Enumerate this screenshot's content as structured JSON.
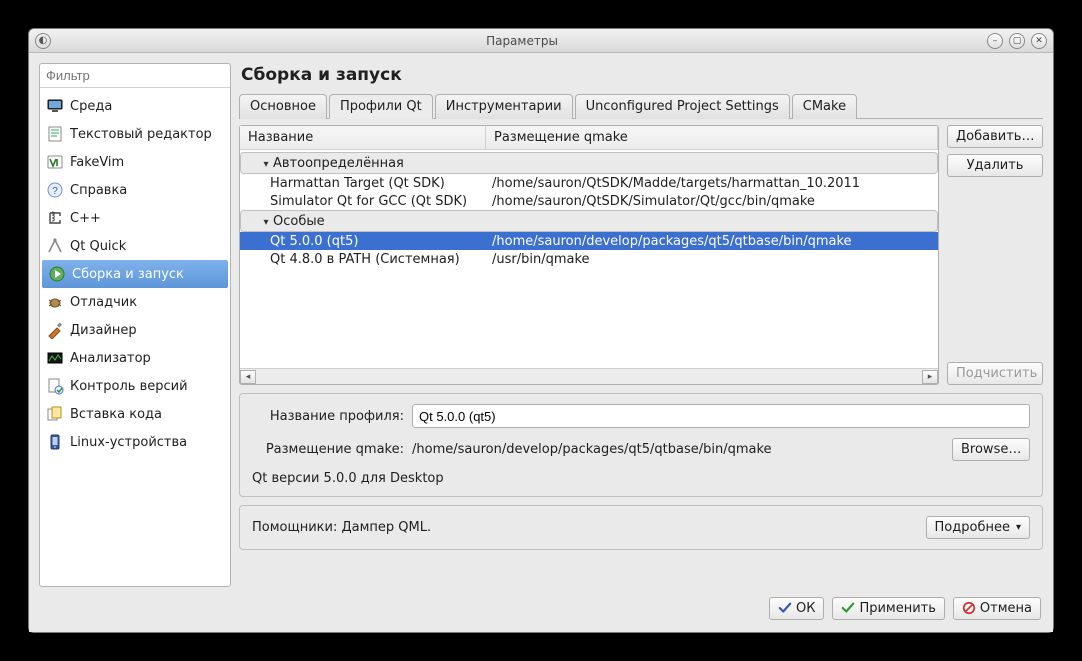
{
  "window": {
    "title": "Параметры"
  },
  "filter": {
    "placeholder": "Фильтр"
  },
  "categories": [
    {
      "label": "Среда",
      "icon": "monitor"
    },
    {
      "label": "Текстовый редактор",
      "icon": "text-editor"
    },
    {
      "label": "FakeVim",
      "icon": "fakevim"
    },
    {
      "label": "Справка",
      "icon": "help"
    },
    {
      "label": "C++",
      "icon": "cpp"
    },
    {
      "label": "Qt Quick",
      "icon": "qtquick"
    },
    {
      "label": "Сборка и запуск",
      "icon": "build-run"
    },
    {
      "label": "Отладчик",
      "icon": "debugger"
    },
    {
      "label": "Дизайнер",
      "icon": "designer"
    },
    {
      "label": "Анализатор",
      "icon": "analyzer"
    },
    {
      "label": "Контроль версий",
      "icon": "vcs"
    },
    {
      "label": "Вставка кода",
      "icon": "code-paste"
    },
    {
      "label": "Linux-устройства",
      "icon": "linux-devices"
    }
  ],
  "selected_category_label": "Сборка и запуск",
  "page": {
    "heading": "Сборка и запуск",
    "tabs": [
      "Основное",
      "Профили Qt",
      "Инструментарии",
      "Unconfigured Project Settings",
      "CMake"
    ],
    "active_tab": "Профили Qt"
  },
  "versions_table": {
    "columns": [
      "Название",
      "Размещение qmake"
    ],
    "groups": [
      {
        "label": "Автоопределённая",
        "rows": [
          {
            "name": "Harmattan Target (Qt SDK)",
            "qmake": "/home/sauron/QtSDK/Madde/targets/harmattan_10.2011"
          },
          {
            "name": "Simulator Qt for GCC (Qt SDK)",
            "qmake": "/home/sauron/QtSDK/Simulator/Qt/gcc/bin/qmake"
          }
        ]
      },
      {
        "label": "Особые",
        "rows": [
          {
            "name": "Qt 5.0.0 (qt5)",
            "qmake": "/home/sauron/develop/packages/qt5/qtbase/bin/qmake",
            "selected": true
          },
          {
            "name": "Qt 4.8.0 в PATH (Системная)",
            "qmake": "/usr/bin/qmake"
          }
        ]
      }
    ]
  },
  "side_buttons": {
    "add": "Добавить…",
    "remove": "Удалить",
    "cleanup": "Подчистить"
  },
  "details": {
    "name_label": "Название профиля:",
    "name_value": "Qt 5.0.0 (qt5)",
    "qmake_label": "Размещение qmake:",
    "qmake_value": "/home/sauron/develop/packages/qt5/qtbase/bin/qmake",
    "browse": "Browse…",
    "summary": "Qt версии 5.0.0 для Desktop"
  },
  "helpers": {
    "label": "Помощники: Дампер QML.",
    "more": "Подробнее"
  },
  "dialog": {
    "ok": "ОК",
    "apply": "Применить",
    "cancel": "Отмена"
  }
}
